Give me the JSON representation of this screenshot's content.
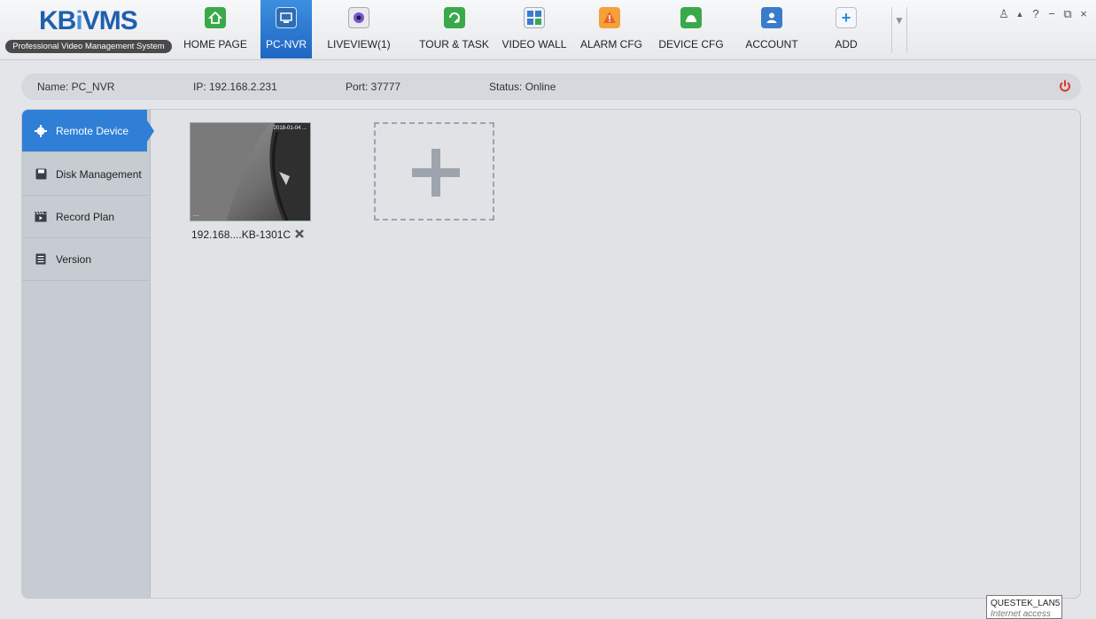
{
  "app": {
    "logo_text_a": "KB",
    "logo_text_b": "i",
    "logo_text_c": "VMS",
    "logo_subtitle": "Professional Video Management System"
  },
  "nav": [
    {
      "label": "HOME PAGE",
      "icon": "home-icon",
      "color": "#3aa94a"
    },
    {
      "label": "PC-NVR",
      "icon": "pc-nvr-icon",
      "color": "#2d6db3"
    },
    {
      "label": "LIVEVIEW(1)",
      "icon": "camera-lens-icon",
      "color": "#7a56c9"
    },
    {
      "label": "TOUR & TASK",
      "icon": "tour-task-icon",
      "color": "#3aa94a"
    },
    {
      "label": "VIDEO WALL",
      "icon": "video-wall-icon",
      "color": "#3a7cc9"
    },
    {
      "label": "ALARM CFG",
      "icon": "alarm-icon",
      "color": "#e8632a"
    },
    {
      "label": "DEVICE CFG",
      "icon": "device-cfg-icon",
      "color": "#3aa94a"
    },
    {
      "label": "ACCOUNT",
      "icon": "account-icon",
      "color": "#3a7cc9"
    },
    {
      "label": "ADD",
      "icon": "plus-icon",
      "color": "#2f86d9"
    }
  ],
  "window_controls": {
    "user": "♙",
    "lock": "▲",
    "help": "?",
    "minimize": "−",
    "restore": "⧉",
    "close": "×"
  },
  "info": {
    "name": "Name:  PC_NVR",
    "ip": "IP:  192.168.2.231",
    "port": "Port:   37777",
    "status": "Status: Online"
  },
  "sidebar": [
    {
      "label": "Remote Device",
      "icon": "gear-icon"
    },
    {
      "label": "Disk Management",
      "icon": "disk-icon"
    },
    {
      "label": "Record Plan",
      "icon": "clapperboard-icon"
    },
    {
      "label": "Version",
      "icon": "document-icon"
    }
  ],
  "devices": [
    {
      "label": "192.168....KB-1301C",
      "overlay_top": "2018-01-04 ...",
      "overlay_bottom": "...."
    }
  ],
  "tooltip": {
    "title": "QUESTEK_LAN5",
    "subtitle": "Internet access"
  }
}
